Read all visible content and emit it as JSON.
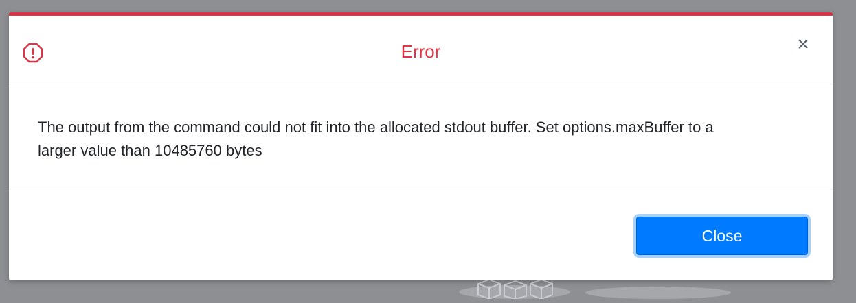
{
  "dialog": {
    "title": "Error",
    "icon": "alert-circle-icon",
    "accent_color": "#dc3545",
    "close_glyph": "×",
    "message": "The output from the command could not fit into the allocated stdout buffer. Set options.maxBuffer to a larger value than 10485760 bytes",
    "close_button_label": "Close",
    "button_color": "#007bff"
  }
}
